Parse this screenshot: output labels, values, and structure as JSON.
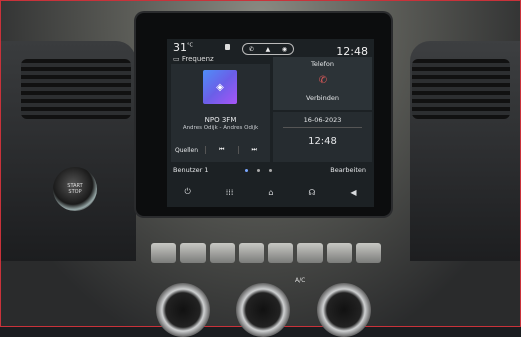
{
  "status_bar": {
    "temperature": "31",
    "temperature_unit": "°C",
    "clock": "12:48"
  },
  "media": {
    "source_label": "Frequenz",
    "station": "NPO 3FM",
    "artist": "Andres Odijk - Andres Odijk",
    "sources_button": "Quellen",
    "prev_icon": "skip-back-icon",
    "next_icon": "skip-forward-icon"
  },
  "phone": {
    "title": "Telefon",
    "connect_label": "Verbinden"
  },
  "datetime": {
    "date": "16-06-2023",
    "time": "12:48"
  },
  "bottom_bar": {
    "user_label": "Benutzer 1",
    "edit_label": "Bearbeiten",
    "page_count": 3,
    "active_page": 1
  },
  "nav_bar": {
    "icons": [
      "power-icon",
      "apps-grid-icon",
      "home-icon",
      "voice-assistant-icon",
      "volume-icon"
    ]
  },
  "colors": {
    "accent": "#7aa7ff",
    "phone_icon": "#e15a5a"
  }
}
